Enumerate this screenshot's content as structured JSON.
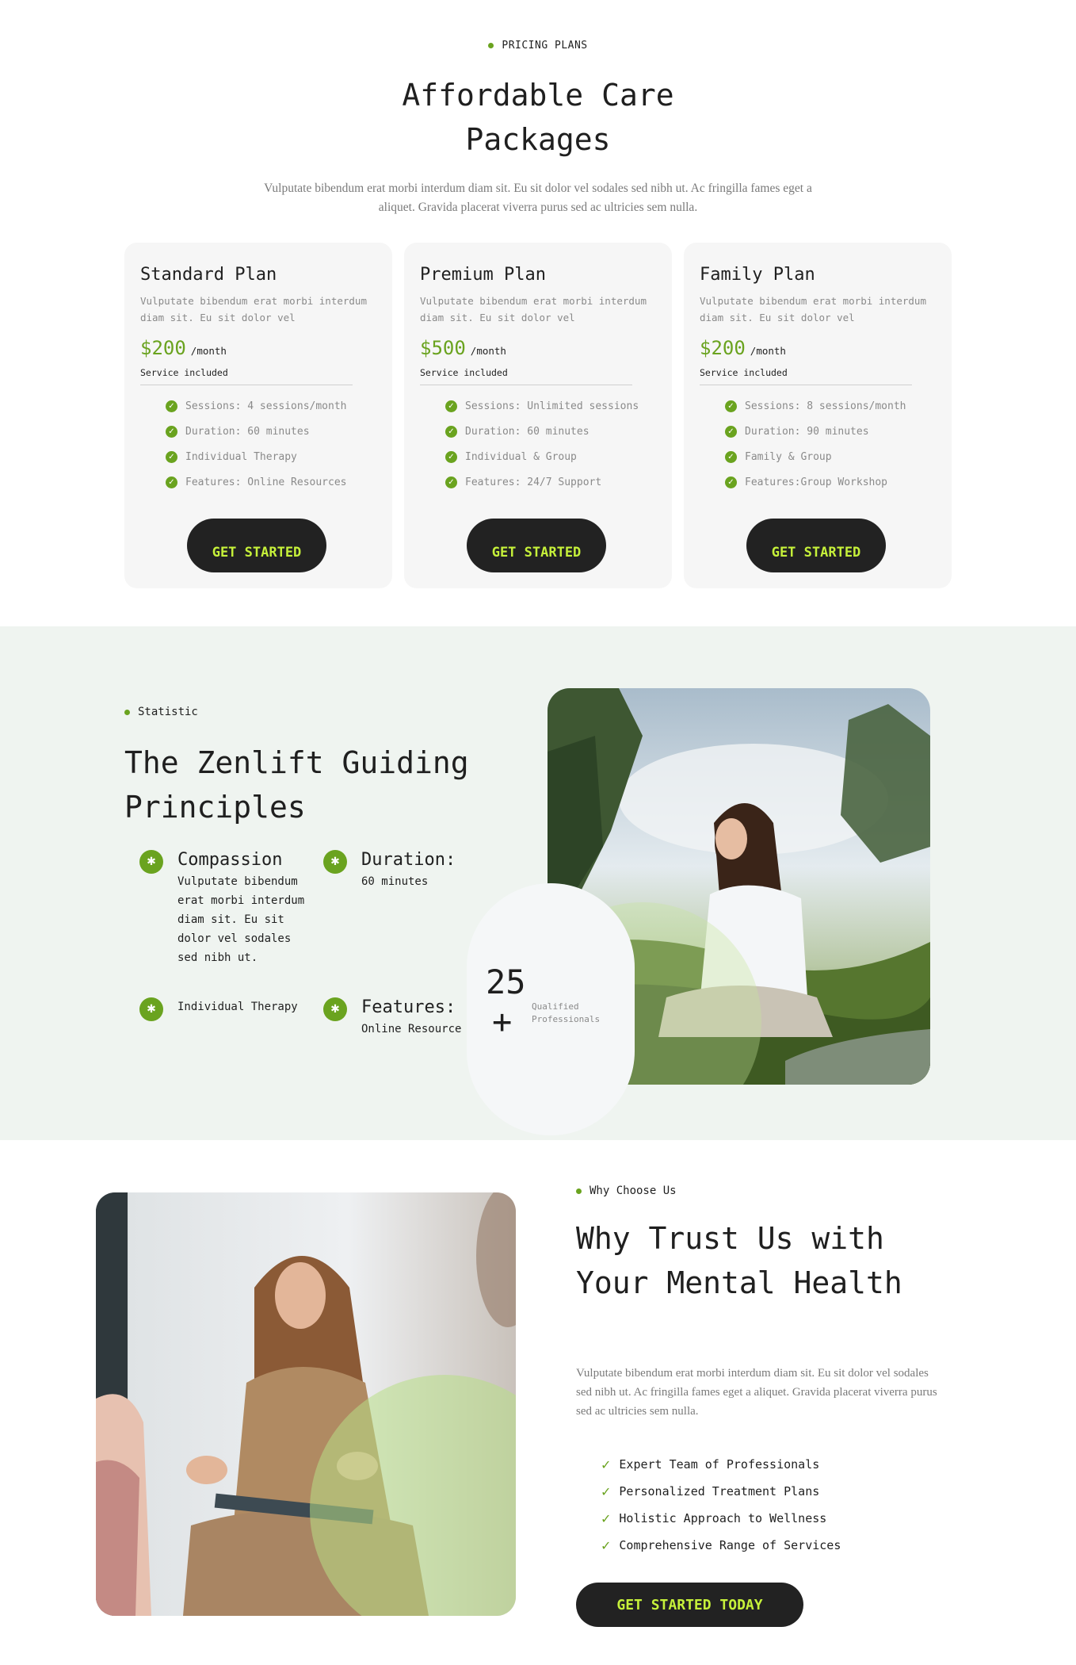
{
  "pricing": {
    "eyebrow": "PRICING PLANS",
    "title": "Affordable Care Packages",
    "description": "Vulputate bibendum erat morbi interdum diam sit. Eu sit dolor vel sodales sed nibh ut. Ac fringilla fames eget a aliquet. Gravida placerat viverra purus sed ac ultricies sem nulla.",
    "plans": [
      {
        "name": "Standard Plan",
        "description": "Vulputate bibendum erat morbi interdum diam sit. Eu sit dolor vel",
        "price": "$200",
        "period": "/month",
        "service_label": "Service included",
        "features": [
          "Sessions: 4 sessions/month",
          "Duration: 60 minutes",
          "Individual Therapy",
          "Features: Online Resources"
        ],
        "button": "GET STARTED"
      },
      {
        "name": "Premium Plan",
        "description": "Vulputate bibendum erat morbi interdum diam sit. Eu sit dolor vel",
        "price": "$500",
        "period": "/month",
        "service_label": "Service included",
        "features": [
          "Sessions: Unlimited sessions",
          "Duration: 60 minutes",
          "Individual & Group",
          "Features: 24/7 Support"
        ],
        "button": "GET STARTED"
      },
      {
        "name": "Family Plan",
        "description": "Vulputate bibendum erat morbi interdum diam sit. Eu sit dolor vel",
        "price": "$200",
        "period": "/month",
        "service_label": "Service included",
        "features": [
          "Sessions: 8 sessions/month",
          "Duration: 90 minutes",
          "Family & Group",
          "Features:Group Workshop"
        ],
        "button": "GET STARTED"
      }
    ]
  },
  "statistic": {
    "eyebrow": "Statistic",
    "title": "The Zenlift Guiding Principles",
    "features": [
      {
        "title": "Compassion",
        "text": "Vulputate bibendum erat morbi interdum diam sit. Eu sit dolor vel sodales sed nibh ut."
      },
      {
        "title": "Duration:",
        "text": "60 minutes"
      },
      {
        "title": "",
        "text": "Individual Therapy"
      },
      {
        "title": "Features:",
        "text": "Online Resource"
      }
    ],
    "counter": {
      "number": "25",
      "suffix": "+",
      "label": "Qualified Professionals"
    }
  },
  "why": {
    "eyebrow": "Why Choose Us",
    "title": "Why Trust Us with Your Mental Health",
    "description": "Vulputate bibendum erat morbi interdum diam sit. Eu sit dolor vel sodales sed nibh ut. Ac fringilla fames eget a aliquet. Gravida placerat viverra purus sed ac ultricies sem nulla.",
    "points": [
      "Expert Team of Professionals",
      "Personalized Treatment Plans",
      "Holistic Approach to Wellness",
      "Comprehensive Range of Services"
    ],
    "button": "GET STARTED TODAY"
  },
  "colors": {
    "accent": "#6aa31f",
    "button_bg": "#222222",
    "button_text": "#c6f13a",
    "stats_bg": "#eff4f0",
    "card_bg": "#f6f6f6"
  }
}
